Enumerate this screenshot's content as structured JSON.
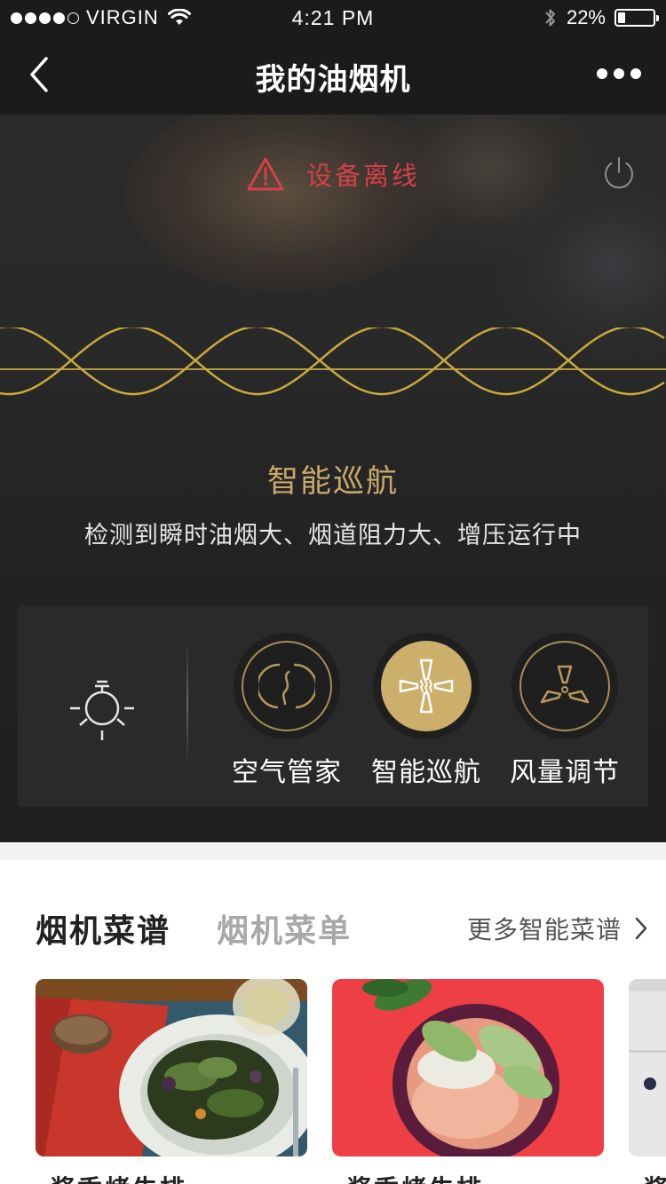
{
  "status_bar": {
    "carrier": "VIRGIN",
    "time": "4:21 PM",
    "battery_percent": "22%",
    "battery_level": 0.22,
    "signal_bars_filled": 4,
    "signal_bars_total": 5
  },
  "nav": {
    "title": "我的油烟机",
    "back_icon": "chevron-left-icon",
    "more_icon": "more-dots-icon"
  },
  "device": {
    "status_text": "设备离线",
    "status_color": "#d5404a",
    "current_mode_title": "智能巡航",
    "current_mode_desc": "检测到瞬时油烟大、烟道阻力大、增压运行中"
  },
  "controls": {
    "light_icon": "light-bulb-icon",
    "modes": [
      {
        "label": "空气管家",
        "icon": "air-manager-icon",
        "active": false
      },
      {
        "label": "智能巡航",
        "icon": "smart-cruise-icon",
        "active": true
      },
      {
        "label": "风量调节",
        "icon": "fan-icon",
        "active": false
      }
    ]
  },
  "recipes": {
    "tabs": [
      {
        "label": "烟机菜谱",
        "active": true
      },
      {
        "label": "烟机菜单",
        "active": false
      }
    ],
    "more_label": "更多智能菜谱",
    "cards": [
      {
        "title": "酱香烤牛排",
        "image": "salad-plate-photo"
      },
      {
        "title": "酱香烤牛排",
        "image": "noodle-bowl-photo"
      },
      {
        "title": "酱",
        "image": "white-plate-photo"
      }
    ]
  },
  "colors": {
    "accent_gold": "#c9a86a",
    "dark_bg": "#1b1b1c",
    "offline_red": "#d5404a"
  }
}
